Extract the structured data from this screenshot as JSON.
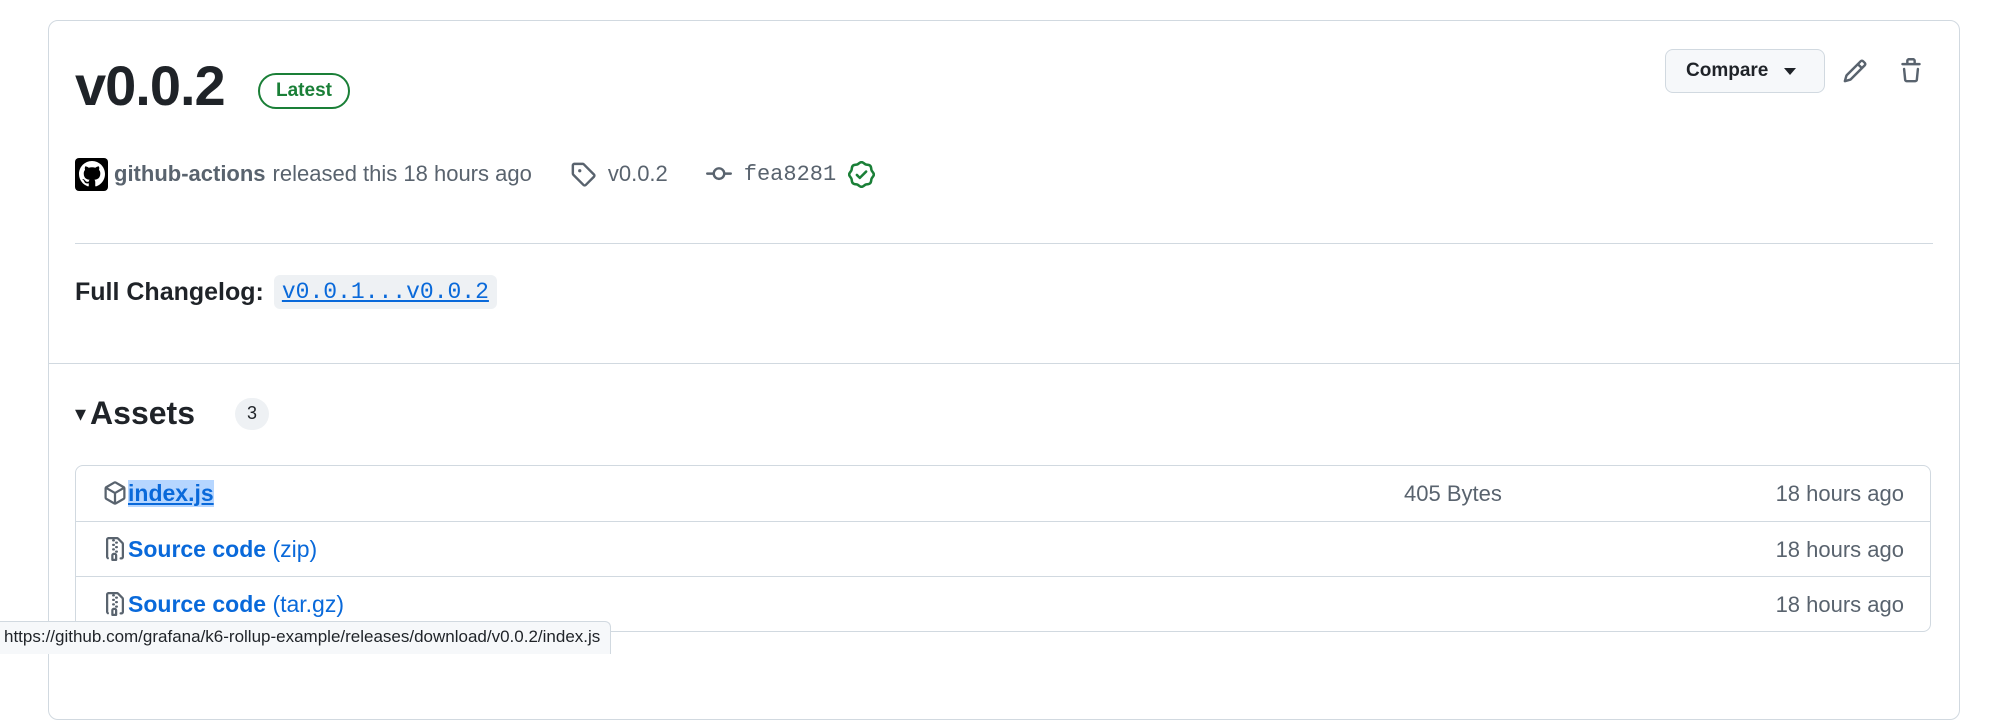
{
  "release": {
    "title": "v0.0.2",
    "badge": "Latest",
    "compare_label": "Compare",
    "author": "github-actions",
    "released_text": "released this 18 hours ago",
    "tag": "v0.0.2",
    "commit": "fea8281"
  },
  "changelog": {
    "label": "Full Changelog:",
    "link_text": "v0.0.1...v0.0.2"
  },
  "assets": {
    "title": "Assets",
    "count": "3",
    "items": [
      {
        "name": "index.js",
        "suffix": "",
        "size": "405 Bytes",
        "time": "18 hours ago",
        "icon": "package-icon"
      },
      {
        "name": "Source code",
        "suffix": "(zip)",
        "size": "",
        "time": "18 hours ago",
        "icon": "file-zip-icon"
      },
      {
        "name": "Source code",
        "suffix": "(tar.gz)",
        "size": "",
        "time": "18 hours ago",
        "icon": "file-zip-icon"
      }
    ]
  },
  "status_bar": {
    "url": "https://github.com/grafana/k6-rollup-example/releases/download/v0.0.2/index.js"
  },
  "colors": {
    "accent": "#0969da",
    "success": "#1a7f37",
    "muted": "#59636e"
  }
}
